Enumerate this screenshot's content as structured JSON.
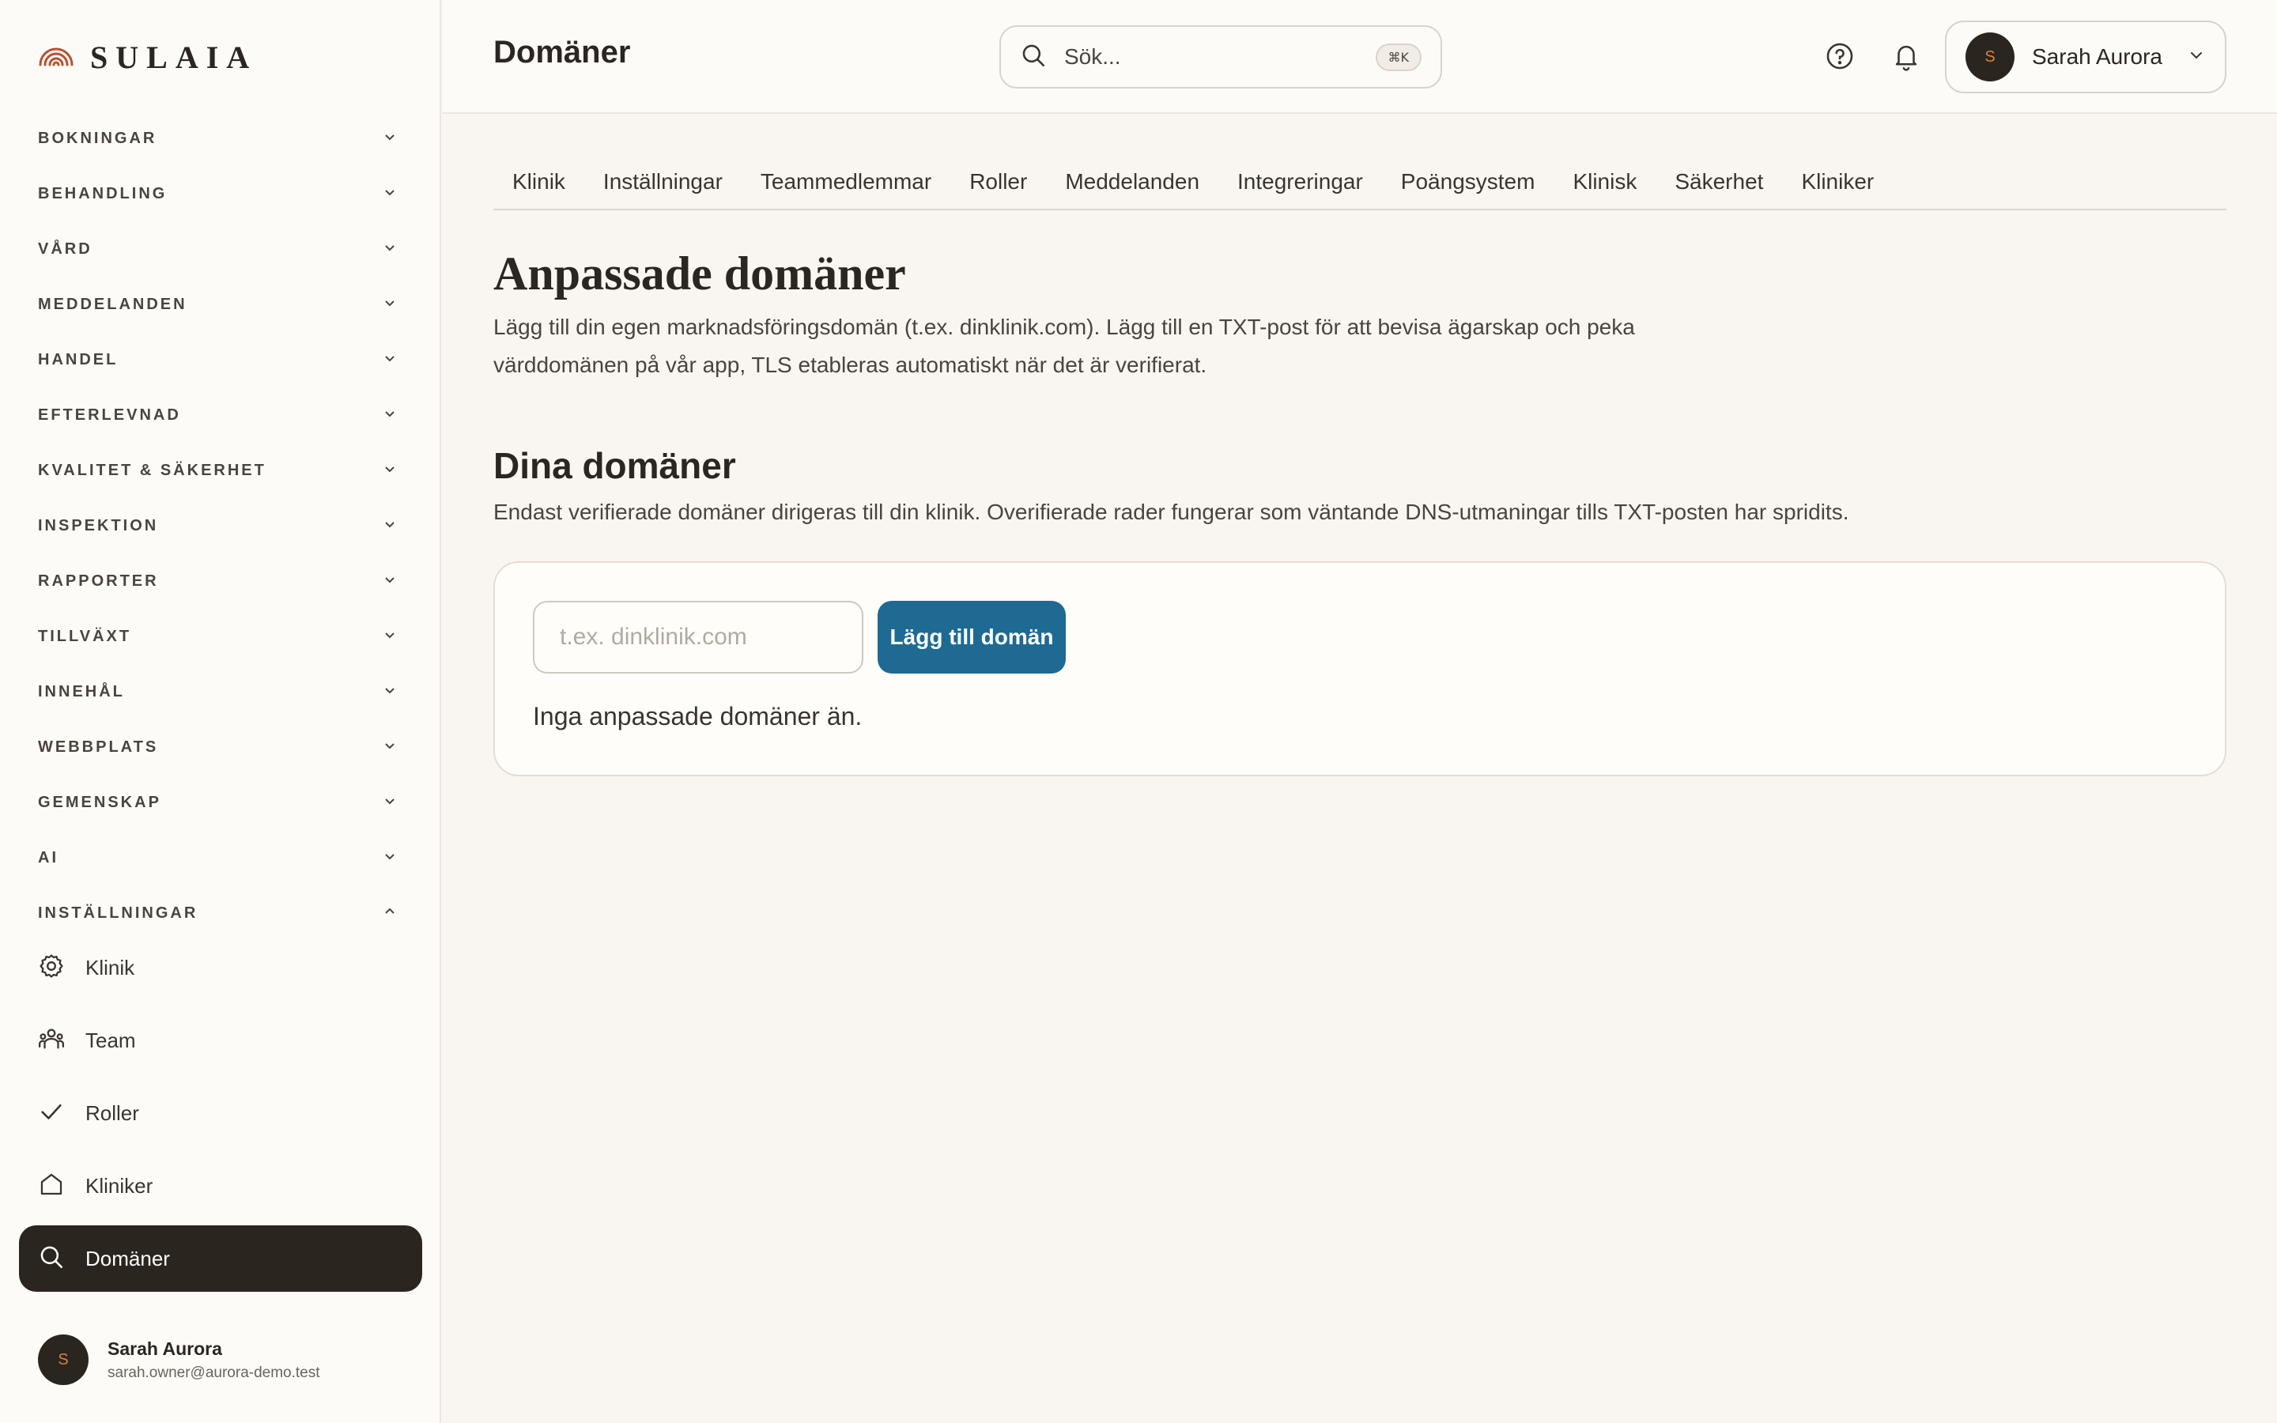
{
  "brand": {
    "name": "SULAIA",
    "accent": "#b8522f"
  },
  "sidebar": {
    "groups": [
      {
        "label": "BOKNINGAR",
        "expanded": false
      },
      {
        "label": "BEHANDLING",
        "expanded": false
      },
      {
        "label": "VÅRD",
        "expanded": false
      },
      {
        "label": "MEDDELANDEN",
        "expanded": false
      },
      {
        "label": "HANDEL",
        "expanded": false
      },
      {
        "label": "EFTERLEVNAD",
        "expanded": false
      },
      {
        "label": "KVALITET & SÄKERHET",
        "expanded": false
      },
      {
        "label": "INSPEKTION",
        "expanded": false
      },
      {
        "label": "RAPPORTER",
        "expanded": false
      },
      {
        "label": "TILLVÄXT",
        "expanded": false
      },
      {
        "label": "INNEHÅL",
        "expanded": false
      },
      {
        "label": "WEBBPLATS",
        "expanded": false
      },
      {
        "label": "GEMENSKAP",
        "expanded": false
      },
      {
        "label": "AI",
        "expanded": false
      },
      {
        "label": "INSTÄLLNINGAR",
        "expanded": true
      }
    ],
    "items": [
      {
        "label": "Klinik",
        "icon": "gear-icon",
        "active": false
      },
      {
        "label": "Team",
        "icon": "team-icon",
        "active": false
      },
      {
        "label": "Roller",
        "icon": "check-icon",
        "active": false
      },
      {
        "label": "Kliniker",
        "icon": "home-icon",
        "active": false
      },
      {
        "label": "Domäner",
        "icon": "search-icon",
        "active": true
      }
    ],
    "user": {
      "initial": "S",
      "name": "Sarah Aurora",
      "email": "sarah.owner@aurora-demo.test"
    }
  },
  "header": {
    "title": "Domäner",
    "search": {
      "placeholder": "Sök...",
      "shortcut": "⌘K"
    },
    "user": {
      "initial": "S",
      "name": "Sarah Aurora"
    }
  },
  "tabs": [
    "Klinik",
    "Inställningar",
    "Teammedlemmar",
    "Roller",
    "Meddelanden",
    "Integreringar",
    "Poängsystem",
    "Klinisk",
    "Säkerhet",
    "Kliniker"
  ],
  "main": {
    "heading": "Anpassade domäner",
    "description": "Lägg till din egen marknadsföringsdomän (t.ex. dinklinik.com). Lägg till en TXT-post för att bevisa ägarskap och peka värddomänen på vår app, TLS etableras automatiskt när det är verifierat.",
    "section_heading": "Dina domäner",
    "section_description": "Endast verifierade domäner dirigeras till din klinik. Overifierade rader fungerar som väntande DNS-utmaningar tills TXT-posten har spridits.",
    "input_placeholder": "t.ex. dinklinik.com",
    "add_button": "Lägg till domän",
    "empty_state": "Inga anpassade domäner än."
  },
  "colors": {
    "primary_button": "#1e6a92",
    "active_nav": "#2b2520"
  }
}
